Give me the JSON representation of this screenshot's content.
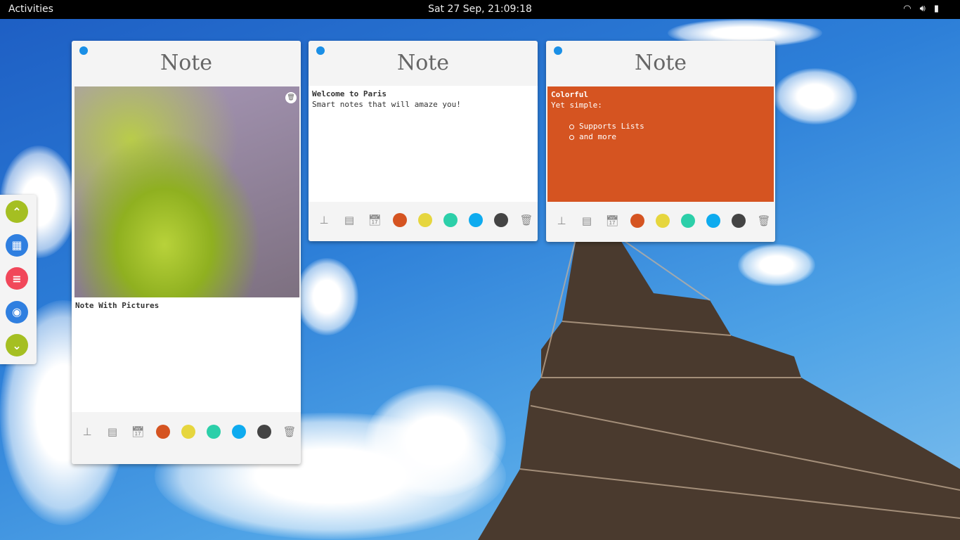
{
  "topbar": {
    "activities": "Activities",
    "clock": "Sat 27 Sep, 21:09:18",
    "icons": [
      "wifi-icon",
      "volume-icon",
      "battery-icon"
    ]
  },
  "sidebar": {
    "buttons": [
      {
        "name": "scroll-up",
        "color": "#a5bf22",
        "glyph": "⌃"
      },
      {
        "name": "grid-view",
        "color": "#2f7fe0",
        "glyph": "▦"
      },
      {
        "name": "list-view",
        "color": "#f1475a",
        "glyph": "≡"
      },
      {
        "name": "preview",
        "color": "#2f7fe0",
        "glyph": "◉"
      },
      {
        "name": "scroll-down",
        "color": "#a5bf22",
        "glyph": "⌄"
      }
    ]
  },
  "notes": [
    {
      "title": "Note",
      "text": "Note With Pictures"
    },
    {
      "title": "Note",
      "heading": "Welcome to Paris",
      "text": "Smart notes that will amaze you!"
    },
    {
      "title": "Note",
      "heading": "Colorful",
      "subheading": "Yet simple:",
      "list": [
        "Supports Lists",
        "and more"
      ],
      "background": "#d55421"
    }
  ],
  "toolbar": {
    "icons": [
      "stamp-icon",
      "list-icon",
      "calendar-icon"
    ],
    "colors": [
      "#d55421",
      "#e6d63e",
      "#2ccfa9",
      "#0eabef",
      "#444444"
    ],
    "trash": "trash-icon"
  }
}
